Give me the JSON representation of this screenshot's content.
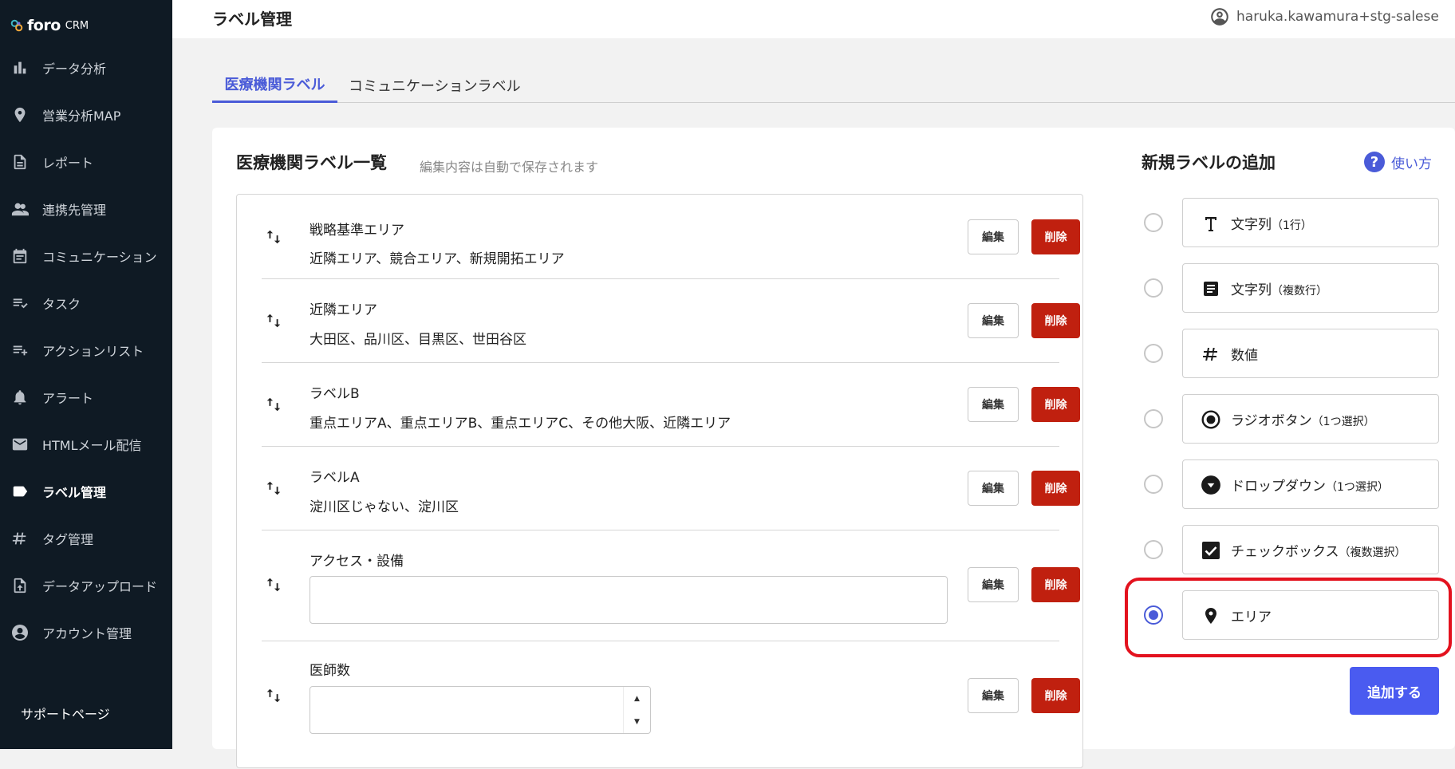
{
  "app": {
    "brand": "foro",
    "brand_suffix": "CRM"
  },
  "sidebar": {
    "items": [
      {
        "label": "データ分析",
        "icon": "bar-chart-icon"
      },
      {
        "label": "営業分析MAP",
        "icon": "map-pin-icon"
      },
      {
        "label": "レポート",
        "icon": "document-icon"
      },
      {
        "label": "連携先管理",
        "icon": "people-icon"
      },
      {
        "label": "コミュニケーション",
        "icon": "calendar-icon"
      },
      {
        "label": "タスク",
        "icon": "checklist-icon"
      },
      {
        "label": "アクションリスト",
        "icon": "playlist-add-icon"
      },
      {
        "label": "アラート",
        "icon": "bell-icon"
      },
      {
        "label": "HTMLメール配信",
        "icon": "mail-icon"
      },
      {
        "label": "ラベル管理",
        "icon": "label-icon",
        "active": true
      },
      {
        "label": "タグ管理",
        "icon": "hash-icon"
      },
      {
        "label": "データアップロード",
        "icon": "upload-file-icon"
      },
      {
        "label": "アカウント管理",
        "icon": "account-circle-icon"
      }
    ],
    "support_label": "サポートページ"
  },
  "header": {
    "title": "ラベル管理",
    "user": "haruka.kawamura+stg-salese"
  },
  "tabs": [
    {
      "label": "医療機関ラベル",
      "active": true
    },
    {
      "label": "コミュニケーションラベル",
      "active": false
    }
  ],
  "list": {
    "title": "医療機関ラベル一覧",
    "note": "編集内容は自動で保存されます",
    "edit_label": "編集",
    "delete_label": "削除",
    "rows": [
      {
        "name": "戦略基準エリア",
        "values": "近隣エリア、競合エリア、新規開拓エリア"
      },
      {
        "name": "近隣エリア",
        "values": "大田区、品川区、目黒区、世田谷区"
      },
      {
        "name": "ラベルB",
        "values": "重点エリアA、重点エリアB、重点エリアC、その他大阪、近隣エリア"
      },
      {
        "name": "ラベルA",
        "values": "淀川区じゃない、淀川区"
      },
      {
        "name": "アクセス・設備",
        "input_value": ""
      },
      {
        "name": "医師数",
        "number_value": ""
      }
    ]
  },
  "add_panel": {
    "title": "新規ラベルの追加",
    "help_label": "使い方",
    "button_label": "追加する",
    "options": [
      {
        "label": "文字列",
        "sub": "（1行）",
        "icon": "text-t-icon",
        "selected": false
      },
      {
        "label": "文字列",
        "sub": "（複数行）",
        "icon": "notes-icon",
        "selected": false
      },
      {
        "label": "数値",
        "sub": "",
        "icon": "hash-icon",
        "selected": false
      },
      {
        "label": "ラジオボタン",
        "sub": "（1つ選択）",
        "icon": "radio-icon",
        "selected": false
      },
      {
        "label": "ドロップダウン",
        "sub": "（1つ選択）",
        "icon": "dropdown-circle-icon",
        "selected": false
      },
      {
        "label": "チェックボックス",
        "sub": "（複数選択）",
        "icon": "checkbox-icon",
        "selected": false
      },
      {
        "label": "エリア",
        "sub": "",
        "icon": "map-pin-icon",
        "selected": true
      }
    ]
  },
  "colors": {
    "accent": "#4a5bd8",
    "danger": "#c0200f",
    "sidebar": "#0f1a24",
    "highlight": "#e3121e"
  }
}
